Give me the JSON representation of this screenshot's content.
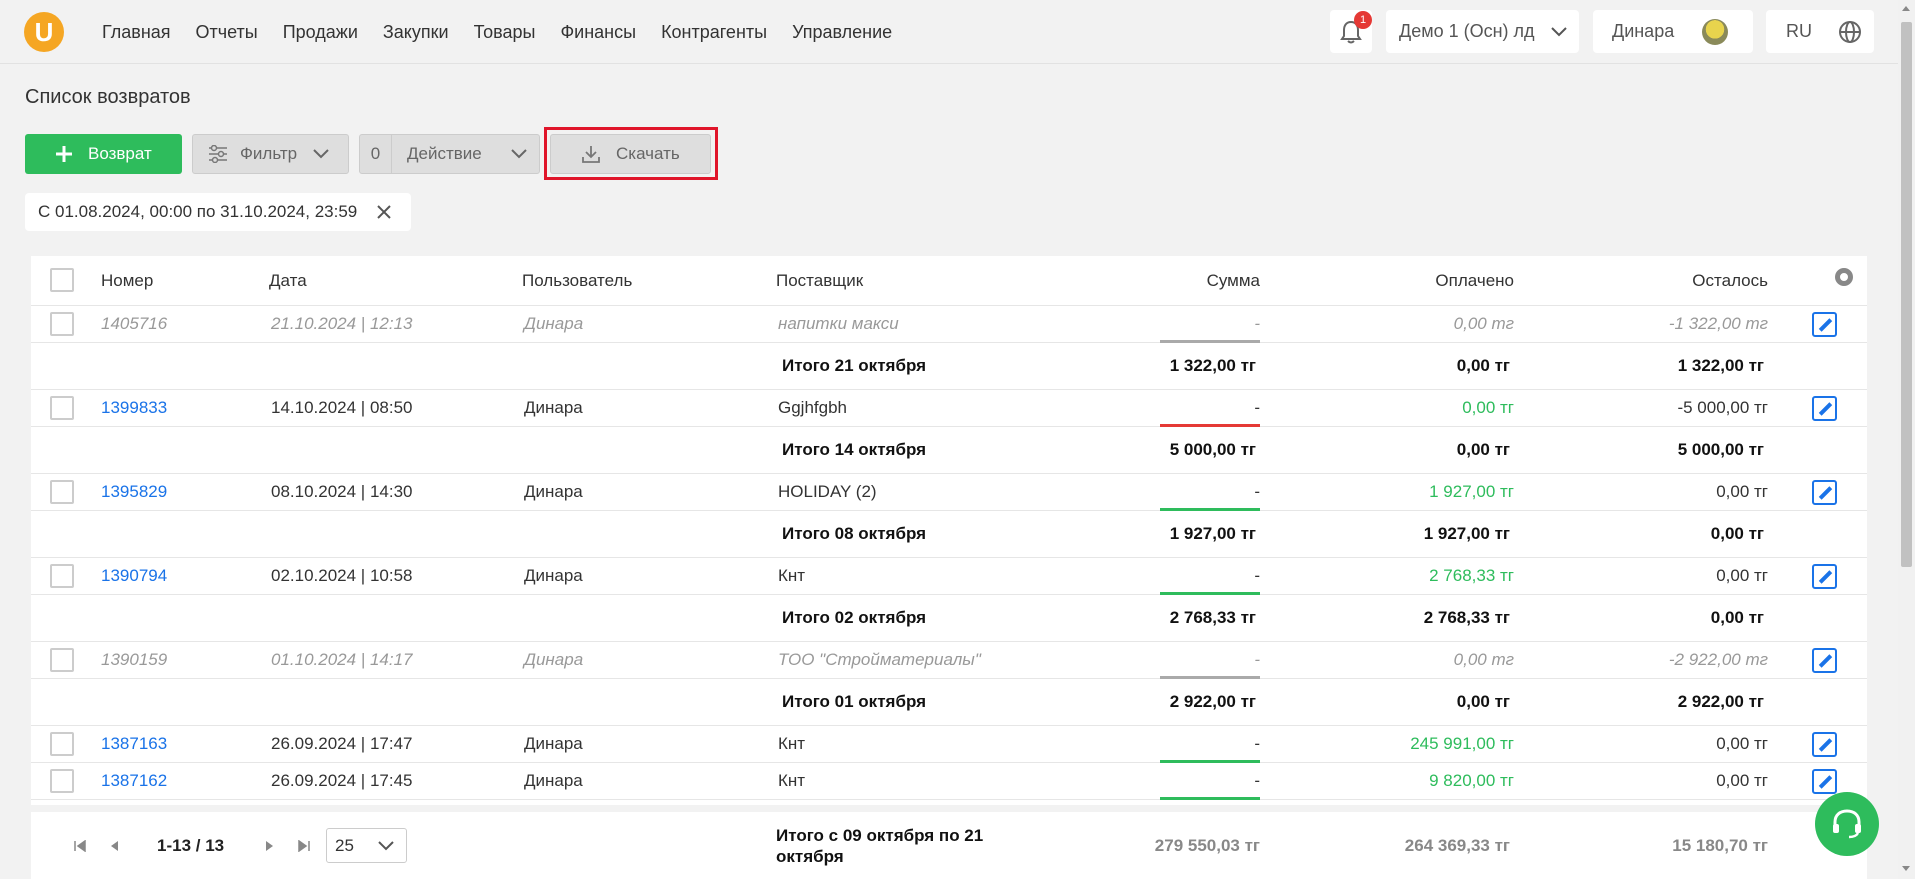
{
  "nav": {
    "logo": "U",
    "items": [
      "Главная",
      "Отчеты",
      "Продажи",
      "Закупки",
      "Товары",
      "Финансы",
      "Контрагенты",
      "Управление"
    ]
  },
  "header": {
    "notif_count": "1",
    "org": "Демо 1 (Осн) лд",
    "user": "Динара",
    "lang": "RU"
  },
  "page": {
    "title": "Список возвратов"
  },
  "toolbar": {
    "add_label": "Возврат",
    "filter_label": "Фильтр",
    "action_count": "0",
    "action_label": "Действие",
    "download_label": "Скачать"
  },
  "filter_chip": "С 01.08.2024, 00:00 по 31.10.2024, 23:59",
  "table": {
    "headers": [
      "Номер",
      "Дата",
      "Пользователь",
      "Поставщик",
      "Сумма",
      "Оплачено",
      "Осталось"
    ],
    "rows": [
      {
        "num": "1405716",
        "date": "21.10.2024 | 12:13",
        "user": "Динара",
        "supplier": "напитки макси",
        "sum": "-",
        "paid": "0,00 тг",
        "left": "-1 322,00 тг"
      },
      {
        "label": "Итого 21 октября",
        "sum": "1 322,00 тг",
        "paid": "0,00 тг",
        "left": "1 322,00 тг"
      },
      {
        "num": "1399833",
        "date": "14.10.2024 | 08:50",
        "user": "Динара",
        "supplier": "Ggjhfgbh",
        "sum": "-",
        "paid": "0,00 тг",
        "left": "-5 000,00 тг"
      },
      {
        "label": "Итого 14 октября",
        "sum": "5 000,00 тг",
        "paid": "0,00 тг",
        "left": "5 000,00 тг"
      },
      {
        "num": "1395829",
        "date": "08.10.2024 | 14:30",
        "user": "Динара",
        "supplier": "HOLIDAY (2)",
        "sum": "-",
        "paid": "1 927,00 тг",
        "left": "0,00 тг"
      },
      {
        "label": "Итого 08 октября",
        "sum": "1 927,00 тг",
        "paid": "1 927,00 тг",
        "left": "0,00 тг"
      },
      {
        "num": "1390794",
        "date": "02.10.2024 | 10:58",
        "user": "Динара",
        "supplier": "Кнт",
        "sum": "-",
        "paid": "2 768,33 тг",
        "left": "0,00 тг"
      },
      {
        "label": "Итого 02 октября",
        "sum": "2 768,33 тг",
        "paid": "2 768,33 тг",
        "left": "0,00 тг"
      },
      {
        "num": "1390159",
        "date": "01.10.2024 | 14:17",
        "user": "Динара",
        "supplier": "ТОО \"Стройматериалы\"",
        "sum": "-",
        "paid": "0,00 тг",
        "left": "-2 922,00 тг"
      },
      {
        "label": "Итого 01 октября",
        "sum": "2 922,00 тг",
        "paid": "0,00 тг",
        "left": "2 922,00 тг"
      },
      {
        "num": "1387163",
        "date": "26.09.2024 | 17:47",
        "user": "Динара",
        "supplier": "Кнт",
        "sum": "-",
        "paid": "245 991,00 тг",
        "left": "0,00 тг"
      },
      {
        "num": "1387162",
        "date": "26.09.2024 | 17:45",
        "user": "Динара",
        "supplier": "Кнт",
        "sum": "-",
        "paid": "9 820,00 тг",
        "left": "0,00 тг"
      }
    ]
  },
  "colors": {
    "accent_green": "#2ebc5c",
    "link_blue": "#1a73e8",
    "bar_red": "#e53935",
    "bar_gray": "#aaaaaa",
    "highlight_red": "#e0152a"
  },
  "footer": {
    "range": "1-13 / 13",
    "page_size": "25",
    "total_label_1": "Итого с 09 октября по 21",
    "total_label_2": "октября",
    "sum": "279 550,03 тг",
    "paid": "264 369,33 тг",
    "left": "15 180,70 тг"
  }
}
